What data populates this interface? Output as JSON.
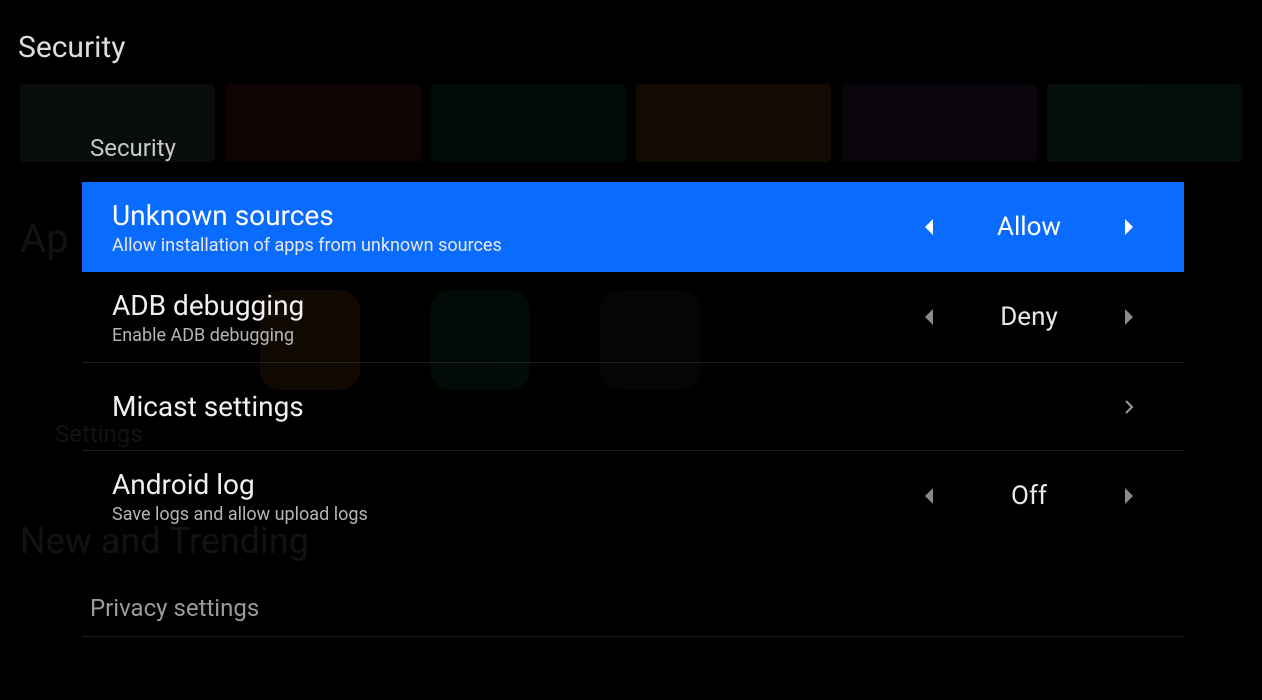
{
  "page_title": "Security",
  "section_title": "Security",
  "section_title_2": "Privacy settings",
  "bg": {
    "apps_label": "Ap",
    "trending_label": "New and Trending",
    "settings_label": "Settings"
  },
  "settings": [
    {
      "title": "Unknown sources",
      "desc": "Allow installation of apps from unknown sources",
      "value": "Allow",
      "highlighted": true
    },
    {
      "title": "ADB debugging",
      "desc": "Enable ADB debugging",
      "value": "Deny",
      "highlighted": false
    },
    {
      "title": "Micast settings",
      "desc": "",
      "value": "",
      "highlighted": false
    },
    {
      "title": "Android log",
      "desc": "Save logs and allow upload logs",
      "value": "Off",
      "highlighted": false
    }
  ]
}
